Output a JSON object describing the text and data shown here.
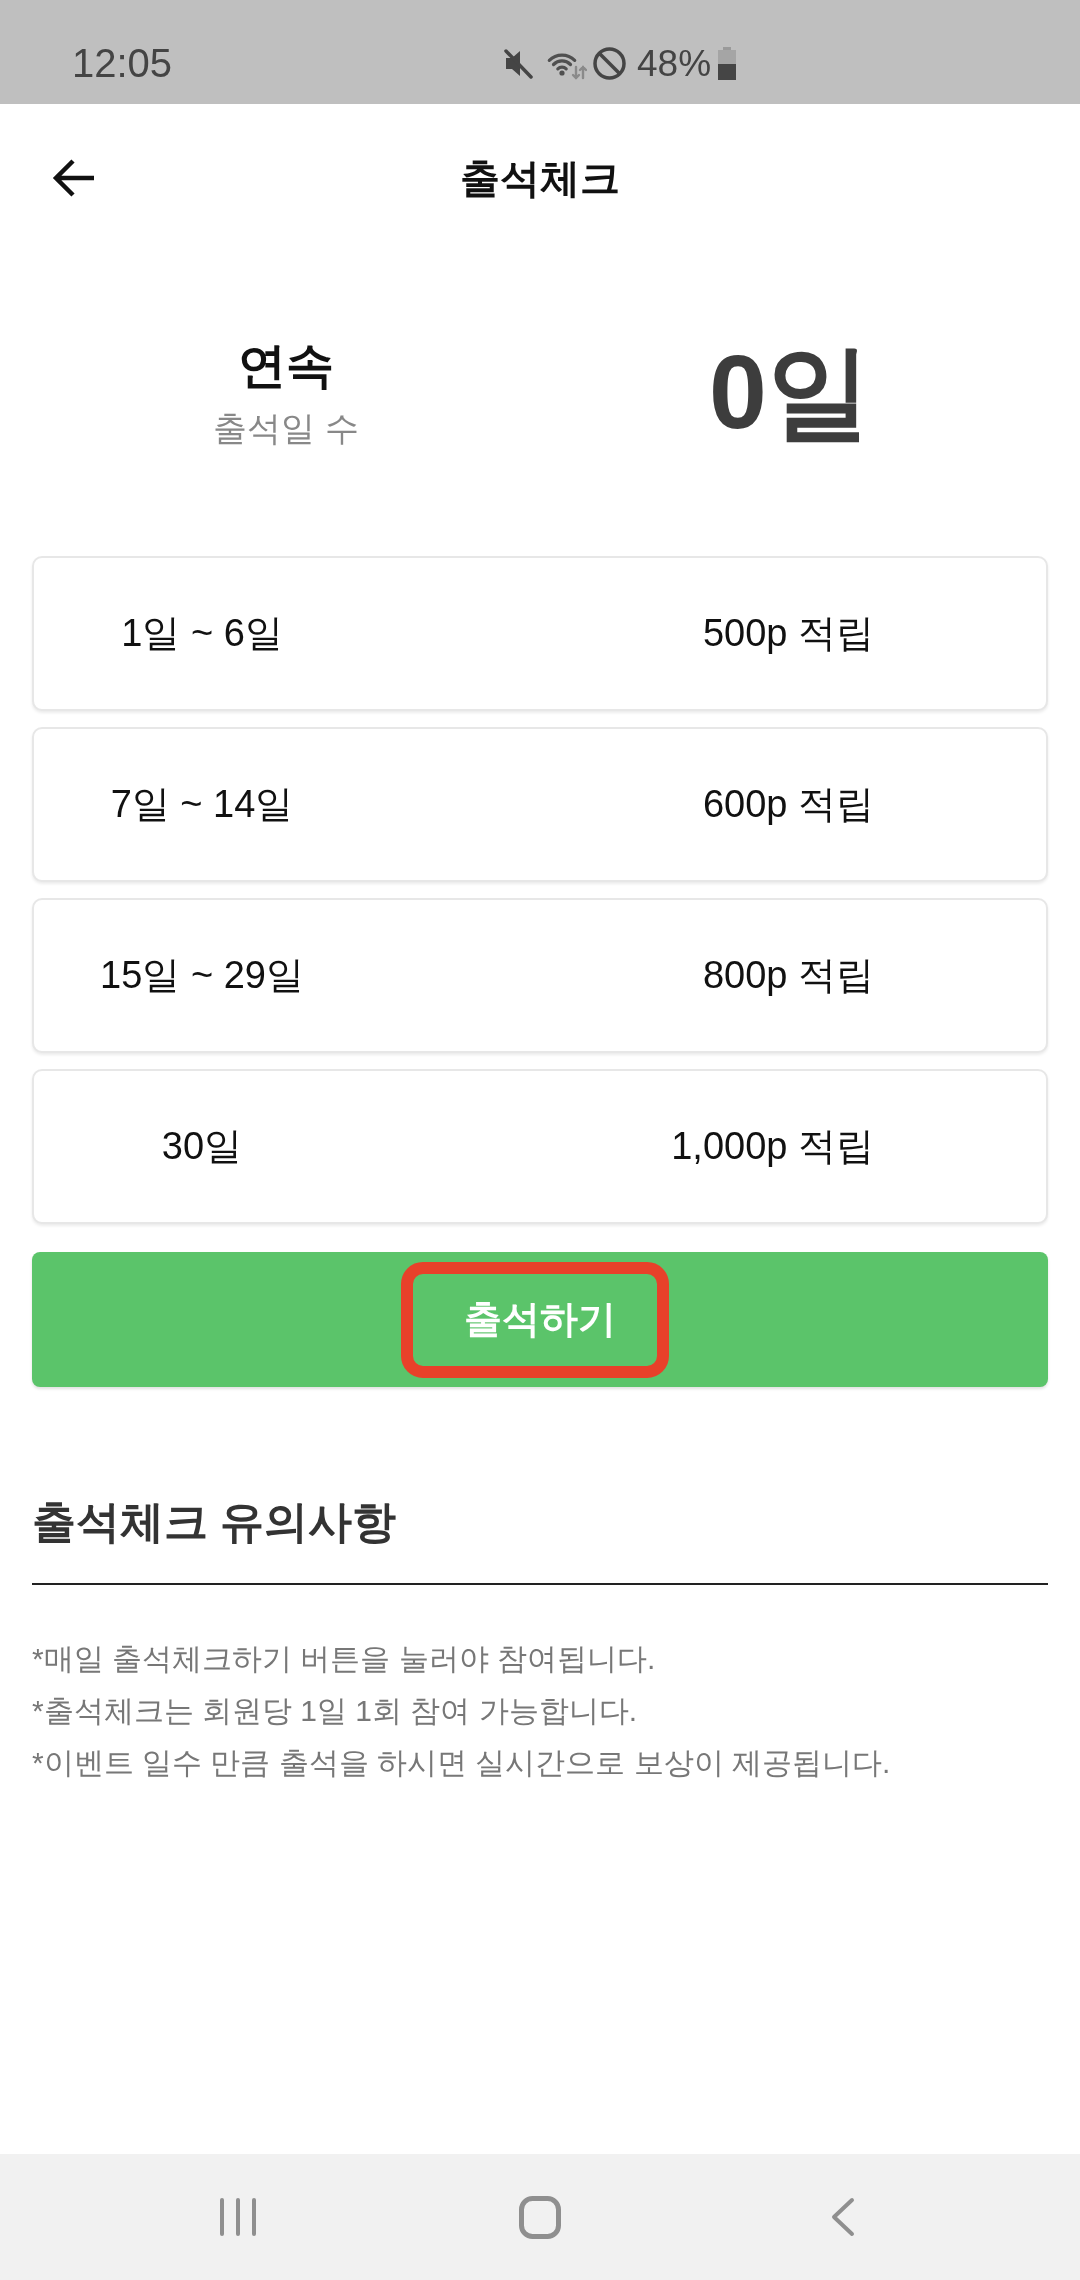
{
  "status_bar": {
    "time": "12:05",
    "battery": "48%"
  },
  "header": {
    "title": "출석체크"
  },
  "streak": {
    "label": "연속",
    "sublabel": "출석일 수",
    "count": "0일"
  },
  "rewards": [
    {
      "days": "1일 ~ 6일",
      "points": "500p 적립"
    },
    {
      "days": "7일 ~ 14일",
      "points": "600p 적립"
    },
    {
      "days": "15일 ~ 29일",
      "points": "800p 적립"
    },
    {
      "days": "30일",
      "points": "1,000p 적립"
    }
  ],
  "check_in_button": {
    "label": "출석하기",
    "highlighted": true
  },
  "notice": {
    "title": "출석체크 유의사항",
    "items": [
      "*매일 출석체크하기 버튼을 눌러야 참여됩니다.",
      "*출석체크는 회원당 1일 1회 참여 가능합니다.",
      "*이벤트 일수 만큼 출석을 하시면 실시간으로 보상이 제공됩니다."
    ]
  }
}
